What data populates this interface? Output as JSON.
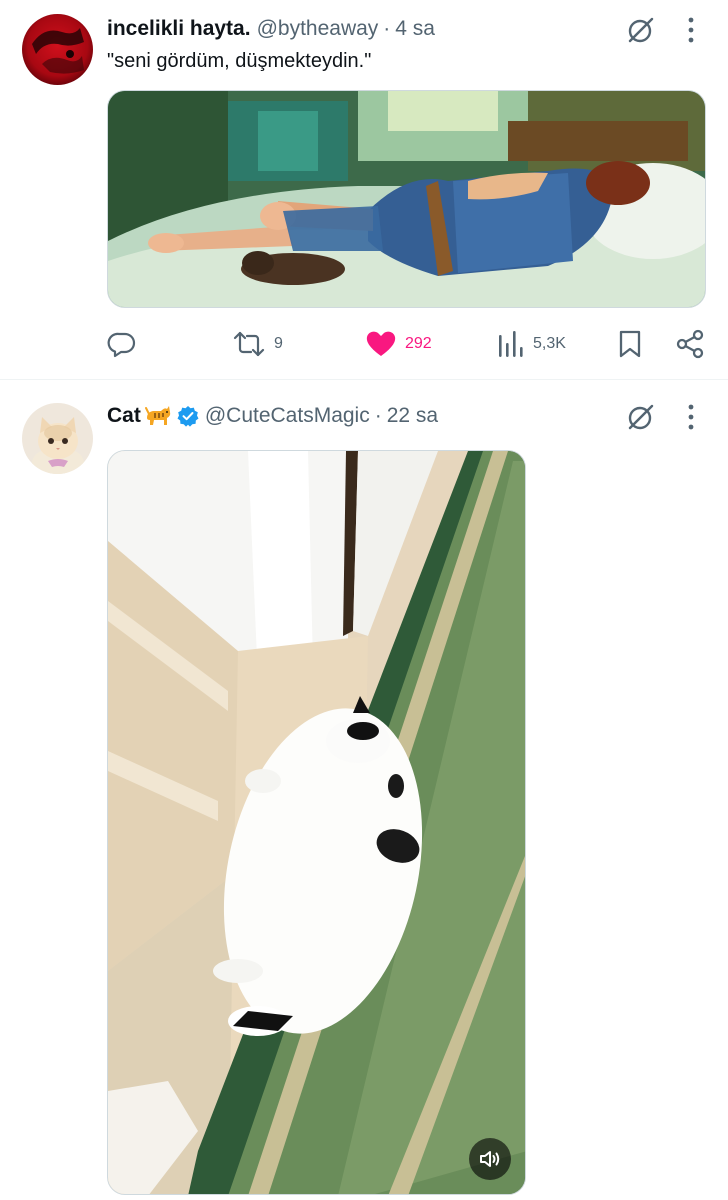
{
  "tweets": [
    {
      "name": "incelikli hayta.",
      "handle": "@bytheaway",
      "separator": "·",
      "time": "4 sa",
      "text": "\"seni gördüm, düşmekteydin.\"",
      "avatar_icon": "dark-red-vinyl-avatar",
      "media": "painting-person-lying-on-bed-with-cat",
      "actions": {
        "reply_count": "",
        "retweet_count": "9",
        "like_count": "292",
        "like_active": true,
        "views_count": "5,3K"
      }
    },
    {
      "name": "Cat",
      "emoji_icon": "cat-emoji",
      "verified": true,
      "handle": "@CuteCatsMagic",
      "separator": "·",
      "time": "22 sa",
      "avatar_icon": "cream-kitten-avatar",
      "media": "video-white-cat-sliding-in-hallway",
      "video_sound_icon": "speaker-icon"
    }
  ],
  "colors": {
    "accent_blue": "#1d9bf0",
    "like_pink": "#f91880",
    "secondary_text": "#536471",
    "primary_text": "#0f1419",
    "divider": "#eff3f4"
  }
}
